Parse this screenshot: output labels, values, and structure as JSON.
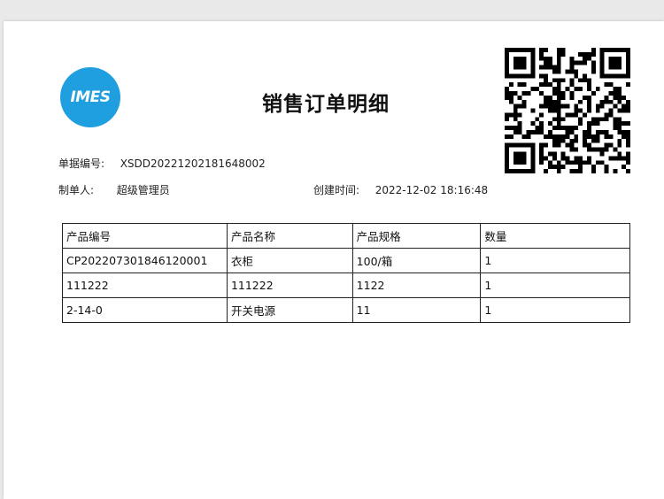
{
  "logo": {
    "text": "IMES"
  },
  "title": "销售订单明细",
  "meta": {
    "order_no_label": "单据编号:",
    "order_no_value": "XSDD20221202181648002",
    "creator_label": "制单人:",
    "creator_value": "超级管理员",
    "created_time_label": "创建时间:",
    "created_time_value": "2022-12-02 18:16:48"
  },
  "table": {
    "headers": [
      "产品编号",
      "产品名称",
      "产品规格",
      "数量"
    ],
    "rows": [
      [
        "CP202207301846120001",
        "衣柜",
        "100/箱",
        "1"
      ],
      [
        "111222",
        "111222",
        "1122",
        "1"
      ],
      [
        "2-14-0",
        "开关电源",
        "11",
        "1"
      ]
    ]
  },
  "colors": {
    "logo_bg": "#1f9fe0",
    "page_bg": "#ffffff",
    "frame_bg": "#e9e9e9"
  },
  "icons": {
    "qr": "qr-code-icon"
  }
}
